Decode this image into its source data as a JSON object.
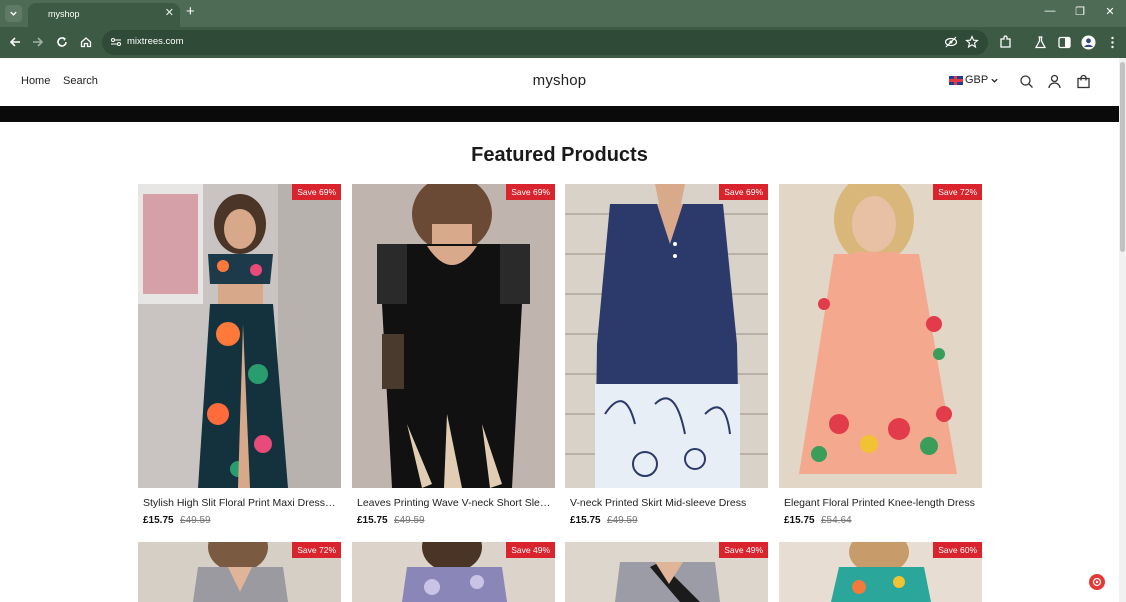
{
  "browser": {
    "tab_title": "myshop",
    "url": "mixtrees.com"
  },
  "header": {
    "nav": [
      "Home",
      "Search"
    ],
    "logo": "myshop",
    "currency": "GBP"
  },
  "section_title": "Featured Products",
  "products": [
    {
      "name": "Stylish High Slit Floral Print Maxi Dress Set",
      "price": "£15.75",
      "compare": "£49.59",
      "badge": "Save 69%"
    },
    {
      "name": "Leaves Printing Wave V-neck Short Sleeve Dress",
      "price": "£15.75",
      "compare": "£49.59",
      "badge": "Save 69%"
    },
    {
      "name": "V-neck Printed Skirt Mid-sleeve Dress",
      "price": "£15.75",
      "compare": "£49.59",
      "badge": "Save 69%"
    },
    {
      "name": "Elegant Floral Printed Knee-length Dress",
      "price": "£15.75",
      "compare": "£54.64",
      "badge": "Save 72%"
    }
  ],
  "products_row2_badges": [
    "Save 72%",
    "Save 49%",
    "Save 49%",
    "Save 60%"
  ],
  "colors": {
    "browser_frame": "#4e6b55",
    "toolbar": "#3c5a44",
    "sale_badge": "#d9232d"
  }
}
